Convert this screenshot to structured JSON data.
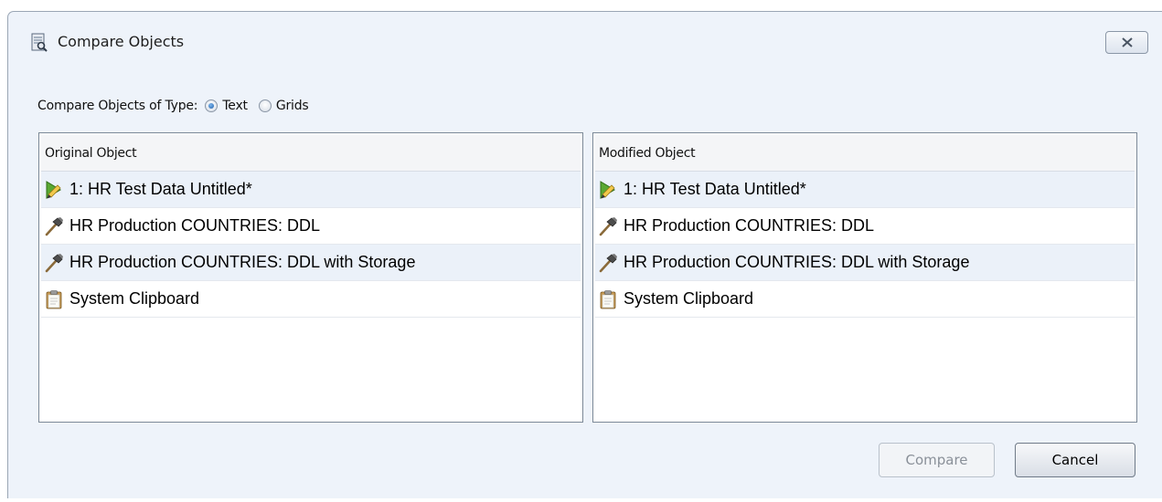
{
  "window": {
    "title": "Compare Objects",
    "close_icon": "close-icon"
  },
  "type_selector": {
    "label": "Compare Objects of Type:",
    "options": [
      {
        "label": "Text",
        "selected": true
      },
      {
        "label": "Grids",
        "selected": false
      }
    ]
  },
  "left_panel": {
    "header": "Original Object",
    "items": [
      {
        "label": "1: HR Test Data Untitled*",
        "icon": "worksheet-pencil-icon"
      },
      {
        "label": "HR Production COUNTRIES: DDL",
        "icon": "hammer-icon"
      },
      {
        "label": "HR Production COUNTRIES: DDL with Storage",
        "icon": "hammer-icon"
      },
      {
        "label": "System Clipboard",
        "icon": "clipboard-icon"
      }
    ]
  },
  "right_panel": {
    "header": "Modified Object",
    "items": [
      {
        "label": "1: HR Test Data Untitled*",
        "icon": "worksheet-pencil-icon"
      },
      {
        "label": "HR Production COUNTRIES: DDL",
        "icon": "hammer-icon"
      },
      {
        "label": "HR Production COUNTRIES: DDL with Storage",
        "icon": "hammer-icon"
      },
      {
        "label": "System Clipboard",
        "icon": "clipboard-icon"
      }
    ]
  },
  "buttons": {
    "compare": {
      "label": "Compare",
      "enabled": false
    },
    "cancel": {
      "label": "Cancel",
      "enabled": true
    }
  },
  "colors": {
    "dialog_bg": "#eef3fa",
    "row_alt": "#ebf1f9",
    "radio_selected": "#1f5fa8"
  }
}
